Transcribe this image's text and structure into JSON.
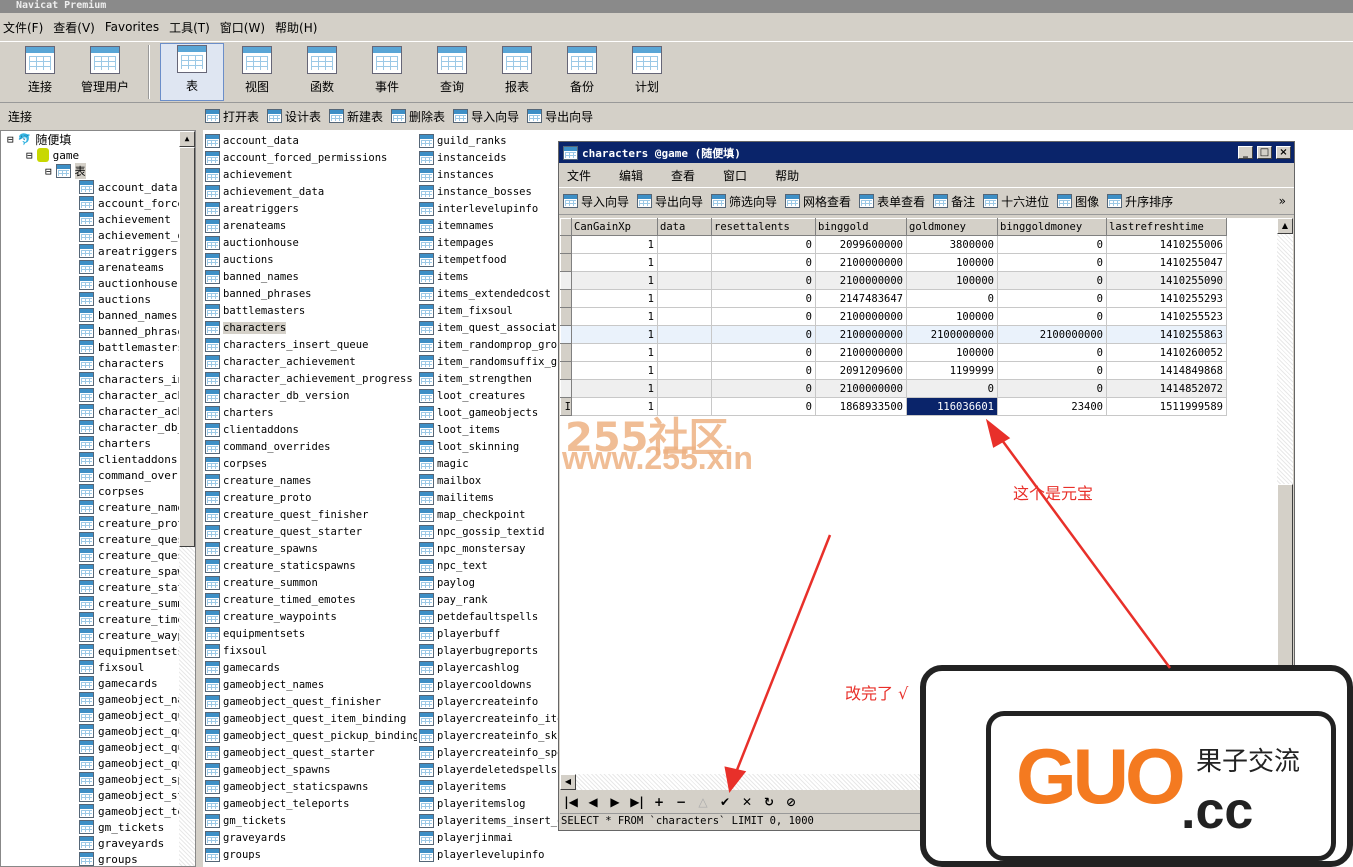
{
  "app": {
    "title": "Navicat Premium"
  },
  "menu": [
    "文件(F)",
    "查看(V)",
    "Favorites",
    "工具(T)",
    "窗口(W)",
    "帮助(H)"
  ],
  "toolbar": [
    {
      "label": "连接",
      "icon": "connection-icon"
    },
    {
      "label": "管理用户",
      "icon": "user-icon"
    },
    {
      "label": "表",
      "icon": "table-icon",
      "active": true
    },
    {
      "label": "视图",
      "icon": "view-icon"
    },
    {
      "label": "函数",
      "icon": "function-icon"
    },
    {
      "label": "事件",
      "icon": "event-icon"
    },
    {
      "label": "查询",
      "icon": "query-icon"
    },
    {
      "label": "报表",
      "icon": "report-icon"
    },
    {
      "label": "备份",
      "icon": "backup-icon"
    },
    {
      "label": "计划",
      "icon": "schedule-icon"
    }
  ],
  "subbar": {
    "label": "连接",
    "actions": [
      "打开表",
      "设计表",
      "新建表",
      "删除表",
      "导入向导",
      "导出向导"
    ]
  },
  "tree": {
    "connection": "随便填",
    "database": "game",
    "group": "表",
    "items": [
      "account_data",
      "account_force",
      "achievement",
      "achievement_da",
      "areatriggers",
      "arenateams",
      "auctionhouse",
      "auctions",
      "banned_names",
      "banned_phrase",
      "battlemasters",
      "characters",
      "characters_ins",
      "character_ach",
      "character_ach",
      "character_db_v",
      "charters",
      "clientaddons",
      "command_overr",
      "corpses",
      "creature_name",
      "creature_proto",
      "creature_quest",
      "creature_quest",
      "creature_spaw",
      "creature_stat",
      "creature_summ",
      "creature_time",
      "creature_wayp",
      "equipmentsets",
      "fixsoul",
      "gamecards",
      "gameobject_nam",
      "gameobject_que",
      "gameobject_que",
      "gameobject_que",
      "gameobject_que",
      "gameobject_spa",
      "gameobject_sta",
      "gameobject_tel",
      "gm_tickets",
      "graveyards",
      "groups"
    ]
  },
  "tables": {
    "selected": "characters",
    "col1": [
      "account_data",
      "account_forced_permissions",
      "achievement",
      "achievement_data",
      "areatriggers",
      "arenateams",
      "auctionhouse",
      "auctions",
      "banned_names",
      "banned_phrases",
      "battlemasters",
      "characters",
      "characters_insert_queue",
      "character_achievement",
      "character_achievement_progress",
      "character_db_version",
      "charters",
      "clientaddons",
      "command_overrides",
      "corpses",
      "creature_names",
      "creature_proto",
      "creature_quest_finisher",
      "creature_quest_starter",
      "creature_spawns",
      "creature_staticspawns",
      "creature_summon",
      "creature_timed_emotes",
      "creature_waypoints",
      "equipmentsets",
      "fixsoul",
      "gamecards",
      "gameobject_names",
      "gameobject_quest_finisher",
      "gameobject_quest_item_binding",
      "gameobject_quest_pickup_binding",
      "gameobject_quest_starter",
      "gameobject_spawns",
      "gameobject_staticspawns",
      "gameobject_teleports",
      "gm_tickets",
      "graveyards",
      "groups"
    ],
    "col2": [
      "guild_ranks",
      "instanceids",
      "instances",
      "instance_bosses",
      "interlevelupinfo",
      "itemnames",
      "itempages",
      "itempetfood",
      "items",
      "items_extendedcost",
      "item_fixsoul",
      "item_quest_associati",
      "item_randomprop_grou",
      "item_randomsuffix_gr",
      "item_strengthen",
      "loot_creatures",
      "loot_gameobjects",
      "loot_items",
      "loot_skinning",
      "magic",
      "mailbox",
      "mailitems",
      "map_checkpoint",
      "npc_gossip_textid",
      "npc_monstersay",
      "npc_text",
      "paylog",
      "pay_rank",
      "petdefaultspells",
      "playerbuff",
      "playerbugreports",
      "playercashlog",
      "playercooldowns",
      "playercreateinfo",
      "playercreateinfo_ite",
      "playercreateinfo_ski",
      "playercreateinfo_spe",
      "playerdeletedspells",
      "playeritems",
      "playeritemslog",
      "playeritems_insert_q",
      "playerjinmai",
      "playerlevelupinfo"
    ]
  },
  "window": {
    "title": "characters @game (随便填)",
    "menu": [
      "文件",
      "编辑",
      "查看",
      "窗口",
      "帮助"
    ],
    "toolbar": [
      "导入向导",
      "导出向导",
      "筛选向导",
      "网格查看",
      "表单查看",
      "备注",
      "十六进位",
      "图像",
      "升序排序"
    ],
    "columns": [
      "CanGainXp",
      "data",
      "resettalents",
      "binggold",
      "goldmoney",
      "binggoldmoney",
      "lastrefreshtime"
    ],
    "rows": [
      [
        "1",
        "",
        "0",
        "2099600000",
        "3800000",
        "0",
        "1410255006"
      ],
      [
        "1",
        "",
        "0",
        "2100000000",
        "100000",
        "0",
        "1410255047"
      ],
      [
        "1",
        "",
        "0",
        "2100000000",
        "100000",
        "0",
        "1410255090"
      ],
      [
        "1",
        "",
        "0",
        "2147483647",
        "0",
        "0",
        "1410255293"
      ],
      [
        "1",
        "",
        "0",
        "2100000000",
        "100000",
        "0",
        "1410255523"
      ],
      [
        "1",
        "",
        "0",
        "2100000000",
        "2100000000",
        "2100000000",
        "1410255863"
      ],
      [
        "1",
        "",
        "0",
        "2100000000",
        "100000",
        "0",
        "1410260052"
      ],
      [
        "1",
        "",
        "0",
        "2091209600",
        "1199999",
        "0",
        "1414849868"
      ],
      [
        "1",
        "",
        "0",
        "2100000000",
        "0",
        "0",
        "1414852072"
      ],
      [
        "1",
        "",
        "0",
        "1868933500",
        "116036601",
        "23400",
        "1511999589"
      ]
    ],
    "selected_cell": {
      "row": 9,
      "column": "goldmoney"
    },
    "nav": [
      "|◀",
      "◀",
      "▶",
      "▶|",
      "+",
      "−",
      "△",
      "✔",
      "✕",
      "↻",
      "⊘"
    ],
    "sql": "SELECT * FROM `characters` LIMIT 0, 1000"
  },
  "annotations": {
    "yuanbao": "这个是元宝",
    "done": "改完了 √",
    "color": "#e8302a"
  },
  "watermarks": {
    "site_cn": "255社区",
    "site_url": "www.255.xin",
    "logo": "GUO.cc",
    "logo_cn": "果子交流"
  }
}
